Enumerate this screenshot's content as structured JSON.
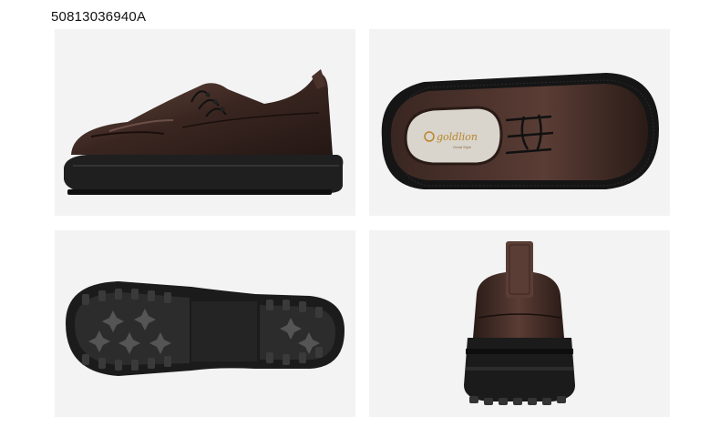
{
  "product": {
    "sku": "50813036940A",
    "brand_logo_text": "goldlion",
    "brand_logo_subtext": "Great Style"
  },
  "views": [
    {
      "name": "side-view"
    },
    {
      "name": "top-view"
    },
    {
      "name": "sole-view"
    },
    {
      "name": "heel-view"
    }
  ],
  "colors": {
    "background": "#ffffff",
    "panel": "#f3f3f3",
    "leather": "#3a2621",
    "leather_highlight": "#6b4a40",
    "sole": "#1f1f1f",
    "insole": "#d9d4cc",
    "logo_gold": "#b8862a"
  }
}
